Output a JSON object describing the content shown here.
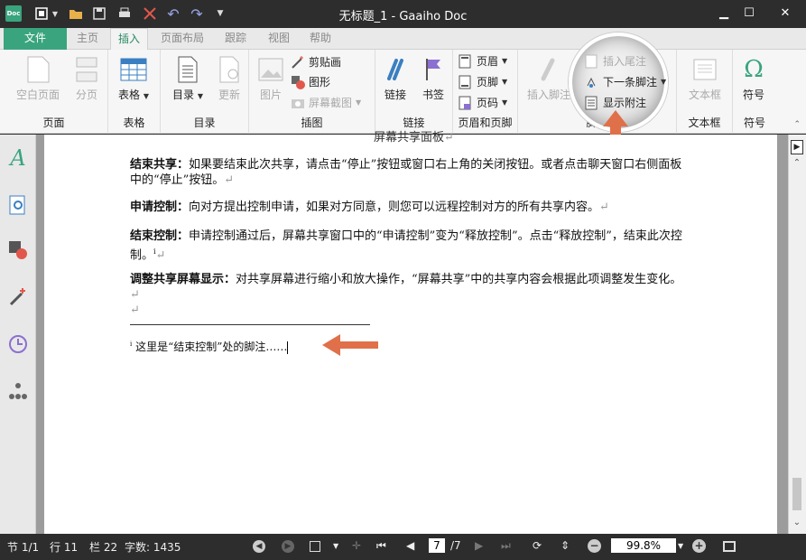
{
  "titlebar": {
    "title": "无标题_1 - Gaaiho Doc",
    "logo": "Doc"
  },
  "tabs": {
    "file": "文件",
    "home": "主页",
    "insert": "插入",
    "layout": "页面布局",
    "track": "跟踪",
    "view": "视图",
    "help": "帮助"
  },
  "ribbon": {
    "page": {
      "label": "页面",
      "blank": "空白页面",
      "break": "分页"
    },
    "table": {
      "label": "表格",
      "table": "表格"
    },
    "toc": {
      "label": "目录",
      "toc": "目录",
      "update": "更新"
    },
    "illus": {
      "label": "插图",
      "picture": "图片",
      "clipart": "剪贴画",
      "shape": "图形",
      "screenshot": "屏幕截图"
    },
    "links": {
      "label": "链接",
      "link": "链接",
      "bookmark": "书签"
    },
    "hf": {
      "label": "页眉和页脚",
      "header": "页眉",
      "footer": "页脚",
      "pagenum": "页码"
    },
    "footnote": {
      "label": "脚注",
      "insert_footnote": "插入脚注",
      "insert_endnote": "插入尾注",
      "next_footnote": "下一条脚注",
      "show_notes": "显示附注"
    },
    "textbox": {
      "label": "文本框",
      "textbox": "文本框"
    },
    "symbol": {
      "label": "符号",
      "symbol": "符号"
    }
  },
  "document": {
    "top_partial": "屏幕共享面板",
    "p1_bold": "结束共享：",
    "p1_text": "如果要结束此次共享，请点击“停止”按钮或窗口右上角的关闭按钮。或者点击聊天窗口右侧面板中的“停止”按钮。",
    "p2_bold": "申请控制：",
    "p2_text": "向对方提出控制申请，如果对方同意，则您可以远程控制对方的所有共享内容。",
    "p3_bold": "结束控制：",
    "p3_text1": "申请控制通过后，屏幕共享窗口中的“申请控制”变为“释放控制”。点击“释放控制”，结束此次控制。",
    "p3_sup": "i",
    "p4_bold": "调整共享屏幕显示：",
    "p4_text": "对共享屏幕进行缩小和放大操作，“屏幕共享”中的共享内容会根据此项调整发生变化。",
    "para_mark": "↵",
    "footnote_sup": "i",
    "footnote_text": "这里是“结束控制”处的脚注……"
  },
  "status": {
    "section": "节 1/1",
    "line": "行 11",
    "column": "栏 22",
    "wordcount": "字数: 1435",
    "page_current": "7",
    "page_total": "/7",
    "zoom": "99.8%"
  },
  "colors": {
    "accent": "#3aa47e",
    "annotation": "#e0704a"
  }
}
